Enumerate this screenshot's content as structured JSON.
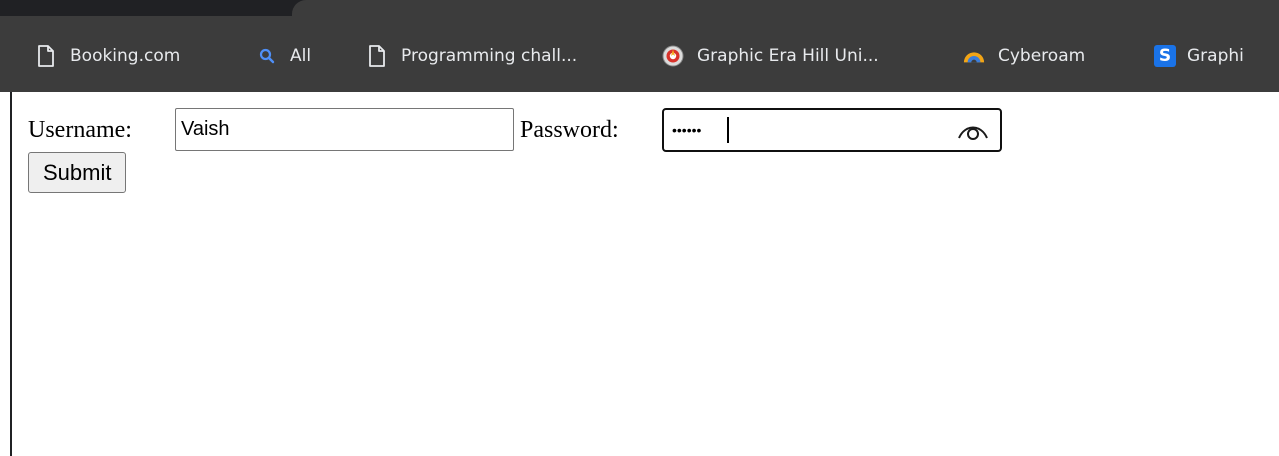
{
  "bookmarks": [
    {
      "label": "Booking.com",
      "icon": "page-icon"
    },
    {
      "label": "All",
      "icon": "search-icon"
    },
    {
      "label": "Programming chall...",
      "icon": "page-icon"
    },
    {
      "label": "Graphic Era Hill Uni...",
      "icon": "university-logo-icon"
    },
    {
      "label": "Cyberoam",
      "icon": "cyberoam-logo-icon"
    },
    {
      "label": "Graphi",
      "icon": "s-logo-icon"
    }
  ],
  "form": {
    "username_label": "Username:",
    "username_value": "Vaish",
    "password_label": "Password:",
    "password_masked": "••••••",
    "submit_label": "Submit"
  },
  "colors": {
    "bookmarks_bar_bg": "#3c3c3c",
    "tab_strip_bg": "#202124",
    "bookmark_text": "#e8eaed",
    "search_icon": "#4f8ff7",
    "s_logo_bg": "#1a73e8"
  }
}
